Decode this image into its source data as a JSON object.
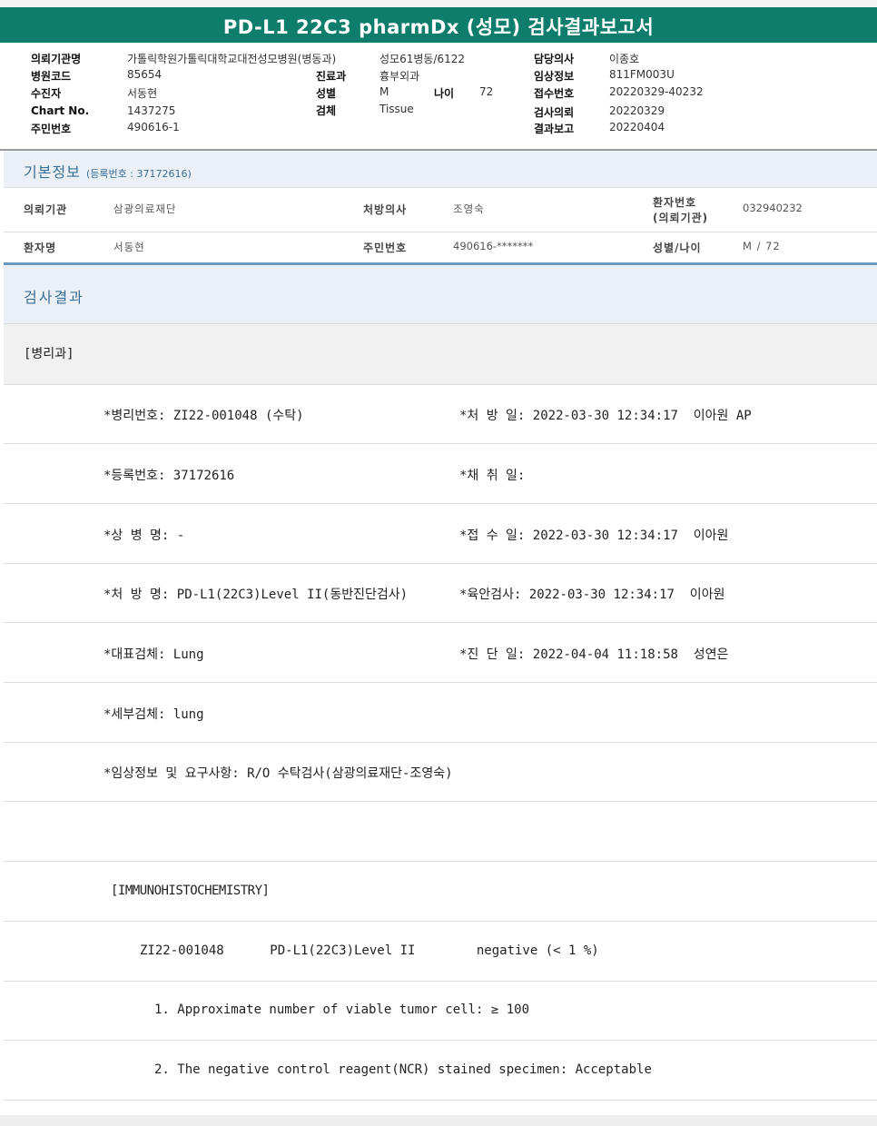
{
  "title": "PD-L1 22C3 pharmDx (성모) 검사결과보고서",
  "header": {
    "request_org_label": "의뢰기관명",
    "request_org_value": "가톨릭학원가톨릭대학교대전성모병원(병동과)",
    "ward_value": "성모61병동/6122",
    "doctor_label": "담당의사",
    "doctor_value": "이종호",
    "hospital_code_label": "병원코드",
    "hospital_code_value": "85654",
    "dept_label": "진료과",
    "dept_value": "흉부외과",
    "clinical_label": "임상정보",
    "clinical_value": "811FM003U",
    "patient_label": "수진자",
    "patient_value": "서동현",
    "sex_label": "성별",
    "sex_value": "M",
    "age_label": "나이",
    "age_value": "72",
    "receipt_no_label": "접수번호",
    "receipt_no_value": "20220329-40232",
    "chart_label": "Chart No.",
    "chart_value": "1437275",
    "specimen_label": "검체",
    "specimen_value": "Tissue",
    "request_date_label": "검사의뢰",
    "request_date_value": "20220329",
    "rrn_label": "주민번호",
    "rrn_value": "490616-1",
    "report_date_label": "결과보고",
    "report_date_value": "20220404"
  },
  "basic_info": {
    "heading": "기본정보",
    "reg_no": "(등록번호 : 37172616)",
    "org_label": "의뢰기관",
    "org_value": "삼광의료재단",
    "prescriber_label": "처방의사",
    "prescriber_value": "조영숙",
    "pt_no_label_1": "환자번호",
    "pt_no_label_2": "(의뢰기관)",
    "pt_no_value": "032940232",
    "name_label": "환자명",
    "name_value": "서동현",
    "rrn_label": "주민번호",
    "rrn_value": "490616-*******",
    "sexage_label": "성별/나이",
    "sexage_value": "M / 72"
  },
  "result": {
    "heading": "검사결과",
    "dept_tag": "[병리과]",
    "lines": [
      "*병리번호: ZI22-001048 (수탁)",
      "*처 방 일: 2022-03-30 12:34:17  이아원 AP",
      "*등록번호: 37172616",
      "*채 취 일:",
      "*상 병 명: -",
      "*접 수 일: 2022-03-30 12:34:17  이아원",
      "*처 방 명: PD-L1(22C3)Level II(동반진단검사)",
      "*육안검사: 2022-03-30 12:34:17  이아원",
      "*대표검체: Lung",
      "*진 단 일: 2022-04-04 11:18:58  성연은",
      "*세부검체: lung",
      "*임상정보 및 요구사항: R/O 수탁검사(삼광의료재단-조영숙)",
      "[IMMUNOHISTOCHEMISTRY]",
      "ZI22-001048      PD-L1(22C3)Level II        negative (< 1 %)",
      "1. Approximate number of viable tumor cell: ≥ 100",
      "2. The negative control reagent(NCR) stained specimen: Acceptable"
    ]
  }
}
